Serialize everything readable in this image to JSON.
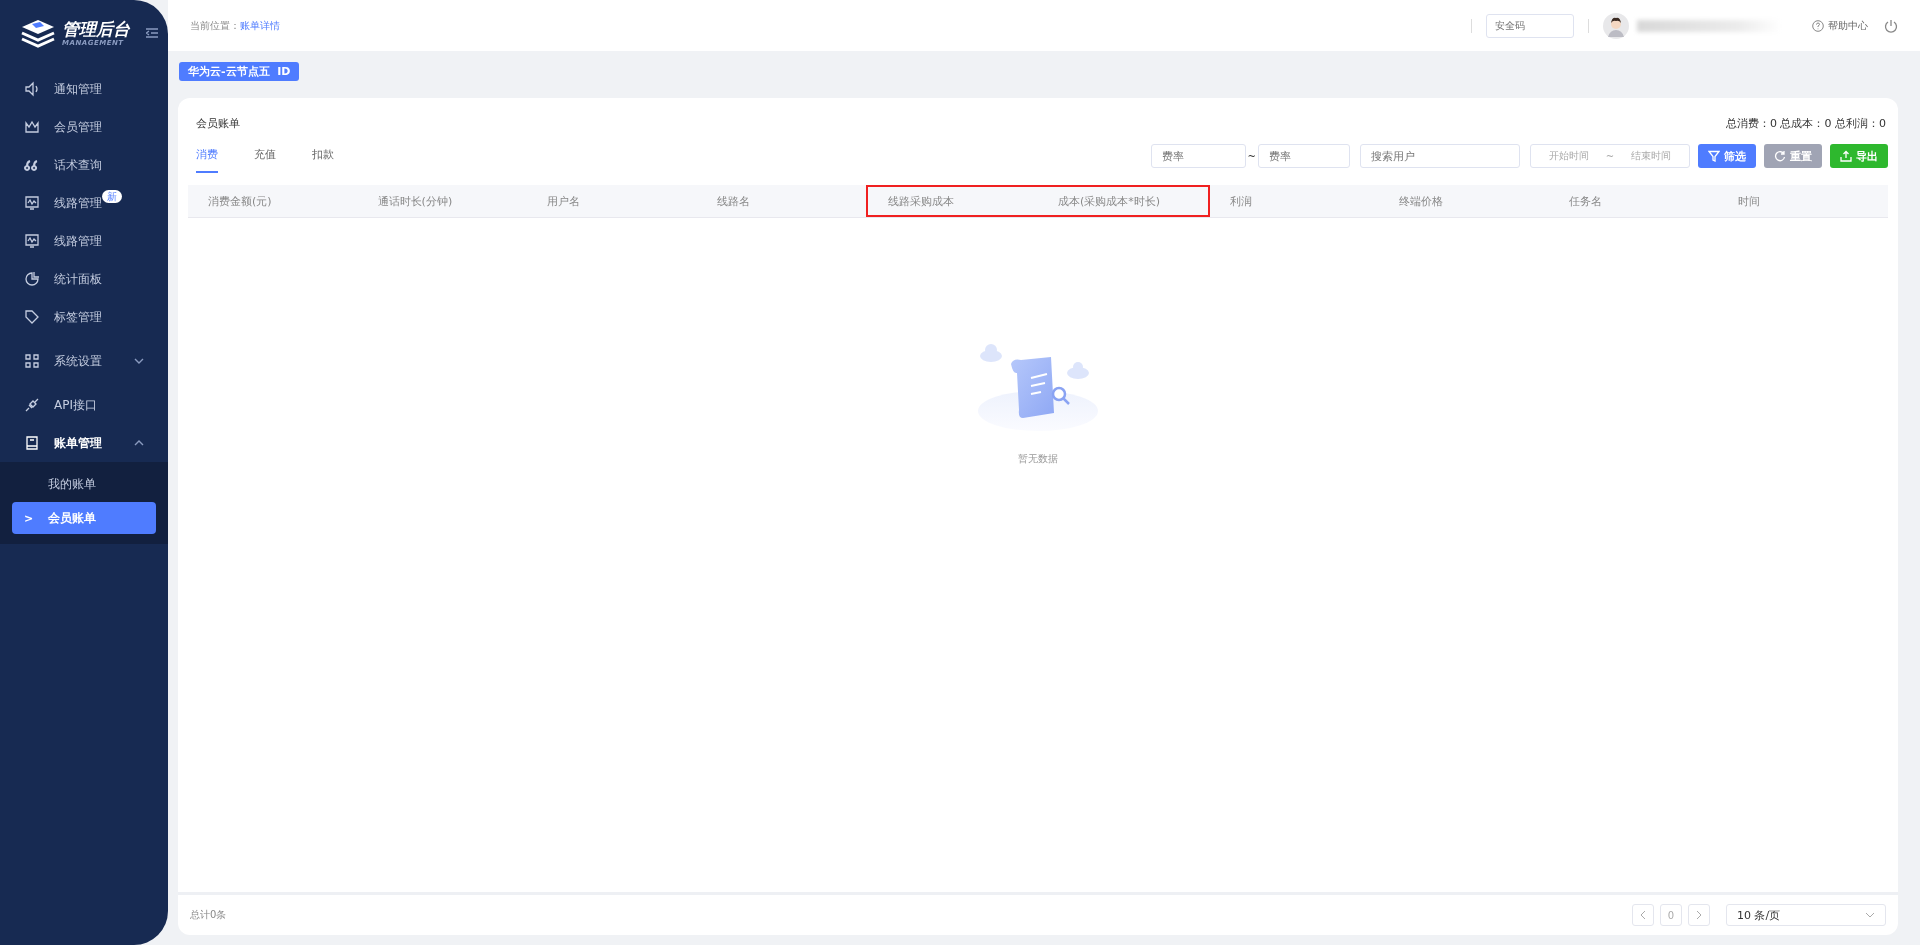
{
  "sidebar": {
    "logo_title": "管理后台",
    "logo_subtitle": "MANAGEMENT",
    "items": [
      {
        "label": "通知管理",
        "selected": false
      },
      {
        "label": "会员管理",
        "selected": false
      },
      {
        "label": "话术查询",
        "selected": false
      },
      {
        "label": "线路管理",
        "selected": false,
        "badge": "新"
      },
      {
        "label": "线路管理",
        "selected": false
      },
      {
        "label": "统计面板",
        "selected": false
      },
      {
        "label": "标签管理",
        "selected": false
      },
      {
        "label": "系统设置",
        "selected": false,
        "expanded": false
      },
      {
        "label": "API接口",
        "selected": false
      },
      {
        "label": "账单管理",
        "selected": true,
        "expanded": true,
        "children": [
          {
            "label": "我的账单",
            "selected": false
          },
          {
            "label": "会员账单",
            "selected": true,
            "arrow": ">"
          }
        ]
      }
    ]
  },
  "header": {
    "breadcrumb_label": "当前位置：",
    "breadcrumb_link": "账单详情",
    "security_code": {
      "placeholder": "安全码"
    },
    "help": "帮助中心"
  },
  "tag": "华为云-云节点五  ID",
  "card": {
    "title": "会员账单",
    "totals": "总消费：0  总成本：0  总利润：0",
    "tabs": [
      {
        "label": "消费",
        "selected": true
      },
      {
        "label": "充值",
        "selected": false
      },
      {
        "label": "扣款",
        "selected": false
      }
    ],
    "filters": {
      "rate_from": {
        "placeholder": "费率"
      },
      "range_sep": "~",
      "rate_to": {
        "placeholder": "费率"
      },
      "user": {
        "placeholder": "搜索用户"
      },
      "start": {
        "placeholder": "开始时间"
      },
      "date_sep": "~",
      "end": {
        "placeholder": "结束时间"
      }
    },
    "buttons": [
      {
        "label": "筛选",
        "kind": "filter"
      },
      {
        "label": "重置",
        "kind": "reset"
      },
      {
        "label": "导出",
        "kind": "export"
      }
    ],
    "columns": [
      {
        "label": "消费金额(元)",
        "highlighted": false
      },
      {
        "label": "通话时长(分钟)",
        "highlighted": false
      },
      {
        "label": "用户名",
        "highlighted": false
      },
      {
        "label": "线路名",
        "highlighted": false
      },
      {
        "label": "线路采购成本",
        "highlighted": true
      },
      {
        "label": "成本(采购成本*时长)",
        "highlighted": true
      },
      {
        "label": "利润",
        "highlighted": false
      },
      {
        "label": "终端价格",
        "highlighted": false
      },
      {
        "label": "任务名",
        "highlighted": false
      },
      {
        "label": "时间",
        "highlighted": false
      }
    ],
    "empty_text": "暂无数据",
    "footer": {
      "total": "总计0条",
      "page": "0",
      "page_size": "10 条/页"
    }
  }
}
